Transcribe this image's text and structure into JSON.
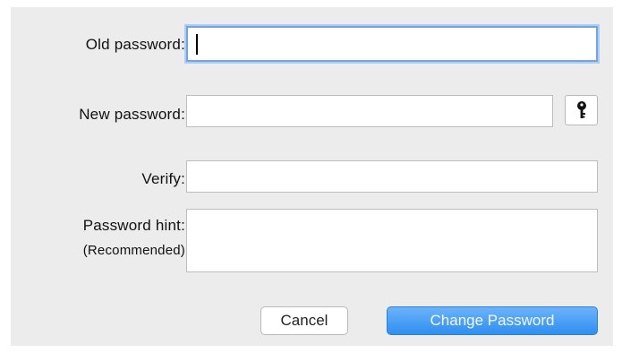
{
  "form": {
    "old_password_label": "Old password:",
    "old_password_value": "",
    "new_password_label": "New password:",
    "new_password_value": "",
    "verify_label": "Verify:",
    "verify_value": "",
    "hint_label": "Password hint:",
    "hint_sublabel": "(Recommended)",
    "hint_value": ""
  },
  "buttons": {
    "cancel_label": "Cancel",
    "change_label": "Change Password",
    "password_assistant_icon": "key-icon"
  },
  "colors": {
    "accent": "#2f8ef0",
    "focus_ring": "#6da5ea",
    "dialog_bg": "#ececec"
  }
}
